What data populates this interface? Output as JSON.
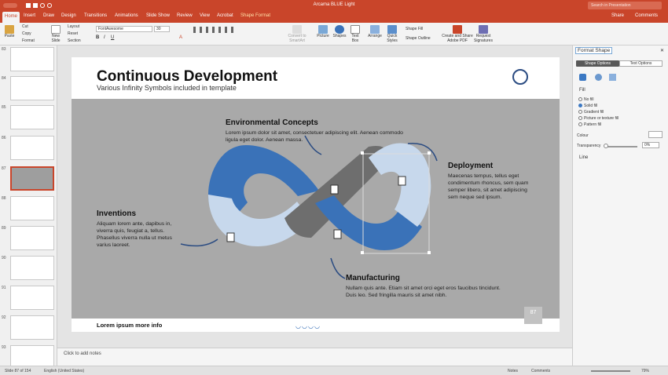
{
  "window": {
    "title": "Arcama BLUE Light",
    "search_placeholder": "Search in Presentation",
    "share": "Share",
    "comments": "Comments"
  },
  "tabs": [
    "Home",
    "Insert",
    "Draw",
    "Design",
    "Transitions",
    "Animations",
    "Slide Show",
    "Review",
    "View",
    "Acrobat",
    "Shape Format"
  ],
  "ribbon": {
    "paste": "Paste",
    "cut": "Cut",
    "copy": "Copy",
    "format": "Format",
    "new_slide": "New Slide",
    "layout": "Layout",
    "reset": "Reset",
    "section": "Section",
    "font": "FontAwesome",
    "font_size": "30",
    "convert": "Convert to SmartArt",
    "picture": "Picture",
    "shapes": "Shapes",
    "text_box": "Text Box",
    "arrange": "Arrange",
    "quick_styles": "Quick Styles",
    "shape_fill": "Shape Fill",
    "shape_outline": "Shape Outline",
    "create_share": "Create and Share Adobe PDF",
    "request_sig": "Request Signatures"
  },
  "thumbnails": [
    "83",
    "84",
    "85",
    "86",
    "87",
    "88",
    "89",
    "90",
    "91",
    "92",
    "93"
  ],
  "slide": {
    "title": "Continuous Development",
    "subtitle": "Various Infinity Symbols included in template",
    "env_title": "Environmental Concepts",
    "env_body": "Lorem ipsum dolor sit amet, consectetuer adipiscing elit. Aenean commodo ligula eget dolor. Aenean massa.",
    "dep_title": "Deployment",
    "dep_body": "Maecenas tempus, tellus eget condimentum rhoncus, sem quam semper libero, sit amet adipiscing sem neque sed ipsum.",
    "inv_title": "Inventions",
    "inv_body": "Aliquam lorem ante, dapibus in, viverra quis, feugiat a, tellus. Phasellus viverra nulla ut metus varius laoreet.",
    "man_title": "Manufacturing",
    "man_body": "Nullam quis ante. Etiam sit amet orci eget eros faucibus tincidunt. Duis leo. Sed fringilla mauris sit amet nibh.",
    "footer": "Lorem ipsum more info",
    "page": "87"
  },
  "notes": "Click to add notes",
  "panel": {
    "title": "Format Shape",
    "tab1": "Shape Options",
    "tab2": "Text Options",
    "fill": "Fill",
    "no_fill": "No fill",
    "solid": "Solid fill",
    "gradient": "Gradient fill",
    "picture": "Picture or texture fill",
    "pattern": "Pattern fill",
    "colour": "Colour",
    "transparency": "Transparency",
    "transparency_value": "0%",
    "line": "Line"
  },
  "status": {
    "slide": "Slide 87 of 154",
    "lang": "English (United States)",
    "notes": "Notes",
    "comments": "Comments",
    "zoom": "79%"
  },
  "colors": {
    "accent": "#c9452a",
    "blue": "#3a72b8",
    "lightblue": "#c7d8ec",
    "gray": "#6e6e6e"
  }
}
